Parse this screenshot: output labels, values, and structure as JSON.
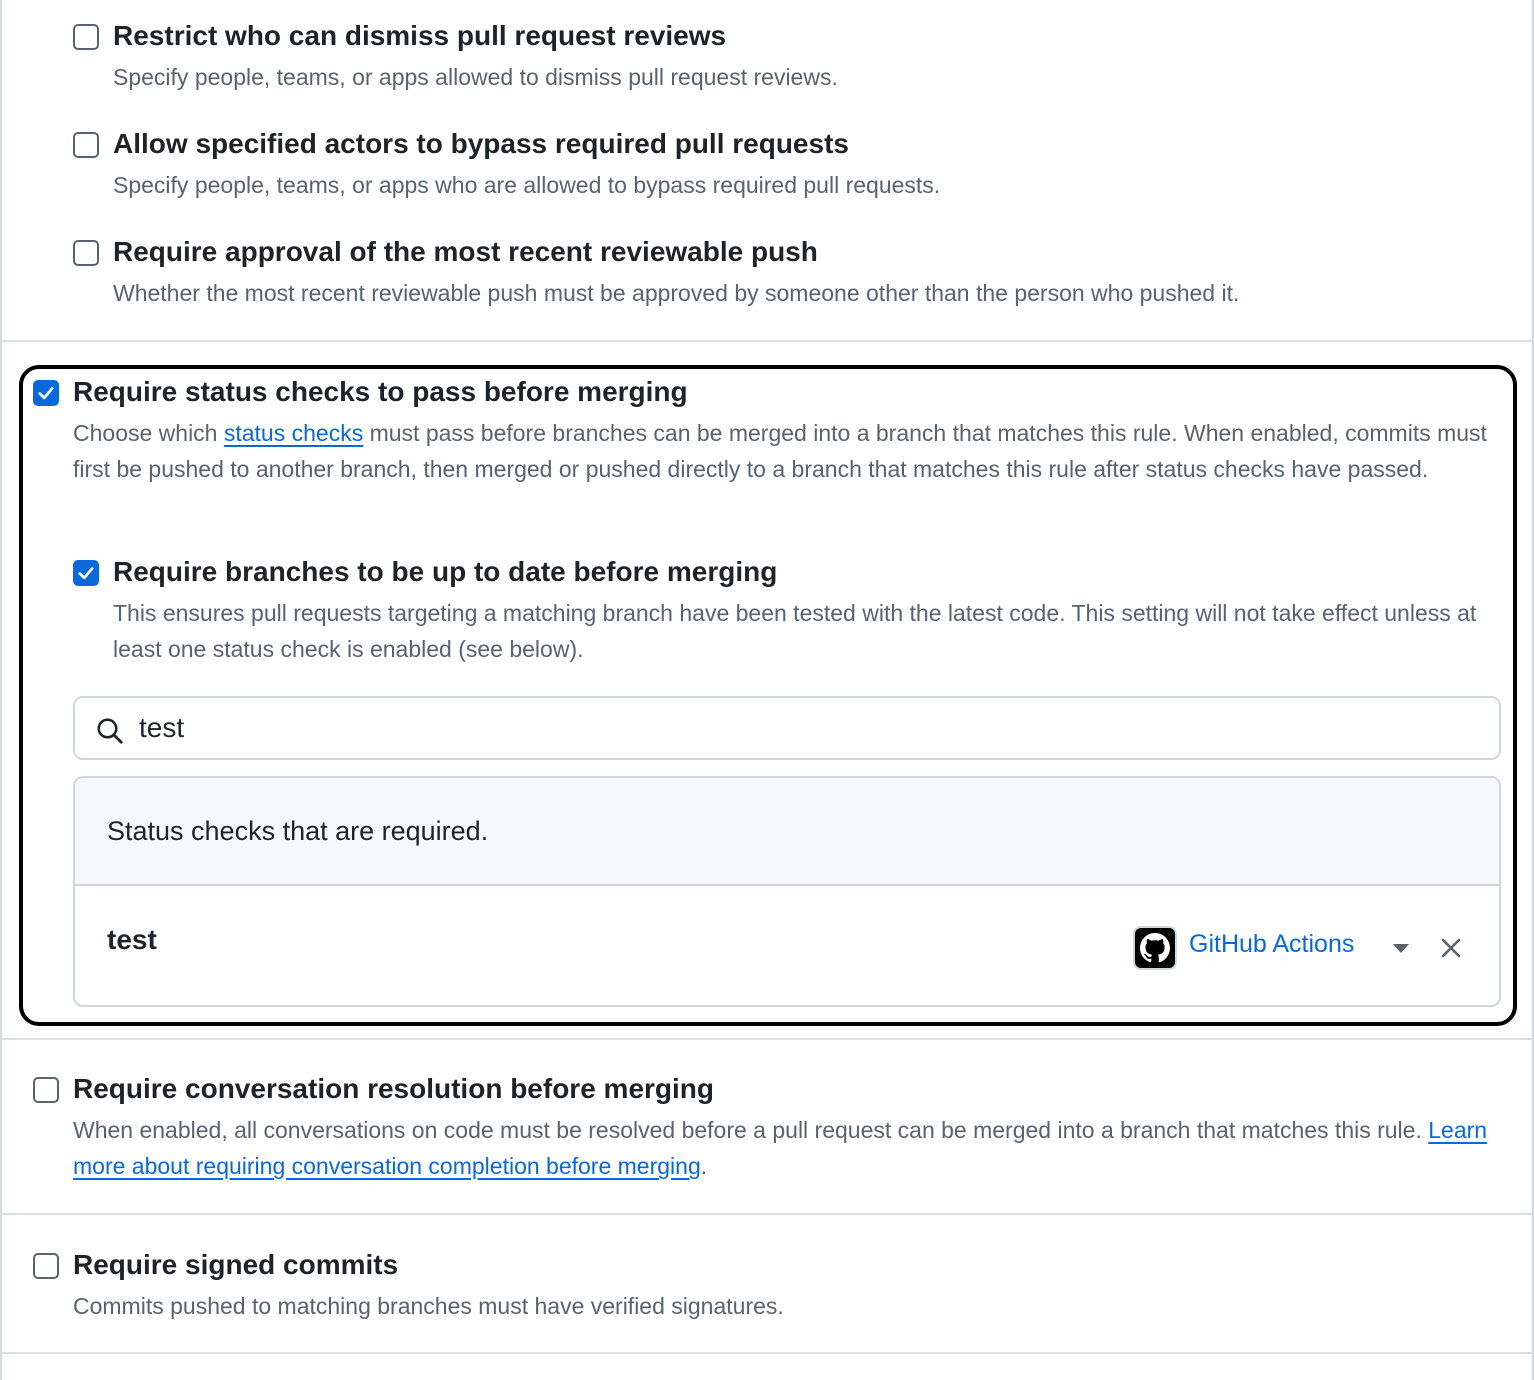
{
  "options": [
    {
      "title": "Restrict who can dismiss pull request reviews",
      "description": "Specify people, teams, or apps allowed to dismiss pull request reviews.",
      "checked": false
    },
    {
      "title": "Allow specified actors to bypass required pull requests",
      "description": "Specify people, teams, or apps who are allowed to bypass required pull requests.",
      "checked": false
    },
    {
      "title": "Require approval of the most recent reviewable push",
      "description": "Whether the most recent reviewable push must be approved by someone other than the person who pushed it.",
      "checked": false
    }
  ],
  "status_checks": {
    "title": "Require status checks to pass before merging",
    "checked": true,
    "desc_before": "Choose which ",
    "desc_link": "status checks",
    "desc_after": " must pass before branches can be merged into a branch that matches this rule. When enabled, commits must first be pushed to another branch, then merged or pushed directly to a branch that matches this rule after status checks have passed.",
    "up_to_date": {
      "title": "Require branches to be up to date before merging",
      "checked": true,
      "description": "This ensures pull requests targeting a matching branch have been tested with the latest code. This setting will not take effect unless at least one status check is enabled (see below)."
    },
    "search_value": "test",
    "required_header": "Status checks that are required.",
    "checks": [
      {
        "name": "test",
        "app": "GitHub Actions",
        "app_icon": "github-logo-icon"
      }
    ]
  },
  "conversation": {
    "title": "Require conversation resolution before merging",
    "checked": false,
    "desc_before": "When enabled, all conversations on code must be resolved before a pull request can be merged into a branch that matches this rule. ",
    "desc_link": "Learn more about requiring conversation completion before merging",
    "desc_after": "."
  },
  "signed_commits": {
    "title": "Require signed commits",
    "checked": false,
    "description": "Commits pushed to matching branches must have verified signatures."
  },
  "colors": {
    "accent": "#0969da",
    "text": "#1f2328",
    "muted": "#59636e",
    "border": "#d0d7de",
    "highlight_border": "#000000"
  }
}
